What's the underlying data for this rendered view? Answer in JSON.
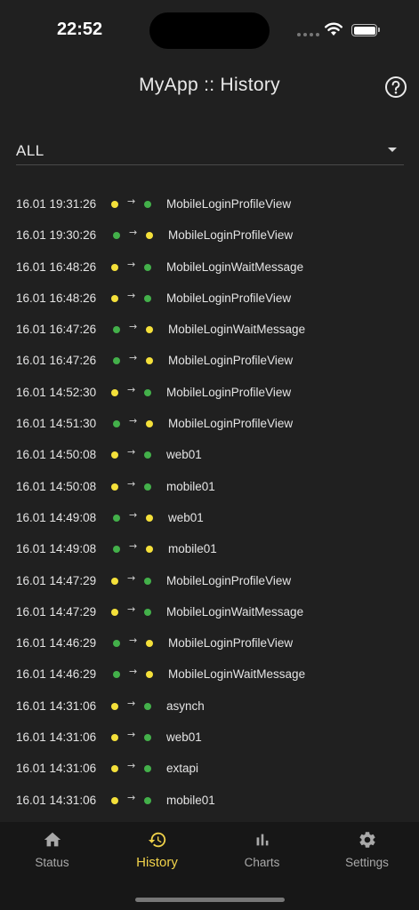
{
  "status_bar": {
    "time": "22:52"
  },
  "header": {
    "title": "MyApp :: History"
  },
  "filter": {
    "value": "ALL"
  },
  "colors": {
    "yellow": "#f4e03a",
    "green": "#43b04a",
    "active_tab": "#f0d24a"
  },
  "arrow_symbol": "→",
  "history": [
    {
      "time": "16.01 19:31:26",
      "from": "yellow",
      "to": "green",
      "name": "MobileLoginProfileView"
    },
    {
      "time": "16.01 19:30:26",
      "from": "green",
      "to": "yellow",
      "name": "MobileLoginProfileView"
    },
    {
      "time": "16.01 16:48:26",
      "from": "yellow",
      "to": "green",
      "name": "MobileLoginWaitMessage"
    },
    {
      "time": "16.01 16:48:26",
      "from": "yellow",
      "to": "green",
      "name": "MobileLoginProfileView"
    },
    {
      "time": "16.01 16:47:26",
      "from": "green",
      "to": "yellow",
      "name": "MobileLoginWaitMessage"
    },
    {
      "time": "16.01 16:47:26",
      "from": "green",
      "to": "yellow",
      "name": "MobileLoginProfileView"
    },
    {
      "time": "16.01 14:52:30",
      "from": "yellow",
      "to": "green",
      "name": "MobileLoginProfileView"
    },
    {
      "time": "16.01 14:51:30",
      "from": "green",
      "to": "yellow",
      "name": "MobileLoginProfileView"
    },
    {
      "time": "16.01 14:50:08",
      "from": "yellow",
      "to": "green",
      "name": "web01"
    },
    {
      "time": "16.01 14:50:08",
      "from": "yellow",
      "to": "green",
      "name": "mobile01"
    },
    {
      "time": "16.01 14:49:08",
      "from": "green",
      "to": "yellow",
      "name": "web01"
    },
    {
      "time": "16.01 14:49:08",
      "from": "green",
      "to": "yellow",
      "name": "mobile01"
    },
    {
      "time": "16.01 14:47:29",
      "from": "yellow",
      "to": "green",
      "name": "MobileLoginProfileView"
    },
    {
      "time": "16.01 14:47:29",
      "from": "yellow",
      "to": "green",
      "name": "MobileLoginWaitMessage"
    },
    {
      "time": "16.01 14:46:29",
      "from": "green",
      "to": "yellow",
      "name": "MobileLoginProfileView"
    },
    {
      "time": "16.01 14:46:29",
      "from": "green",
      "to": "yellow",
      "name": "MobileLoginWaitMessage"
    },
    {
      "time": "16.01 14:31:06",
      "from": "yellow",
      "to": "green",
      "name": "asynch"
    },
    {
      "time": "16.01 14:31:06",
      "from": "yellow",
      "to": "green",
      "name": "web01"
    },
    {
      "time": "16.01 14:31:06",
      "from": "yellow",
      "to": "green",
      "name": "extapi"
    },
    {
      "time": "16.01 14:31:06",
      "from": "yellow",
      "to": "green",
      "name": "mobile01"
    }
  ],
  "tabs": [
    {
      "label": "Status",
      "icon": "home-icon",
      "active": false
    },
    {
      "label": "History",
      "icon": "history-icon",
      "active": true
    },
    {
      "label": "Charts",
      "icon": "bar-chart-icon",
      "active": false
    },
    {
      "label": "Settings",
      "icon": "gear-icon",
      "active": false
    }
  ]
}
